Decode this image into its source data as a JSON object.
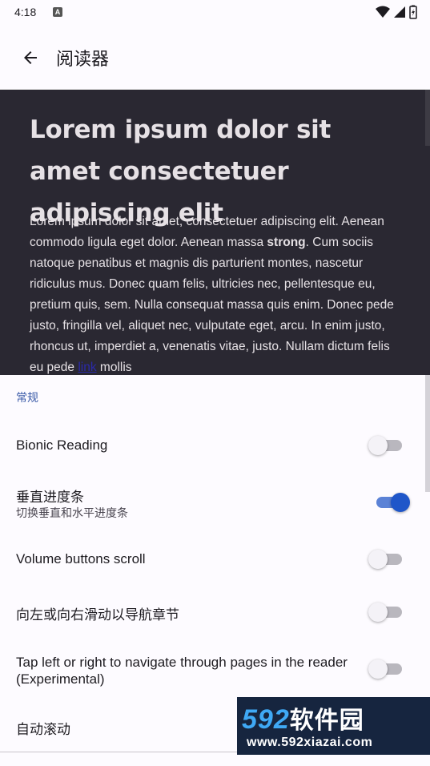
{
  "status_bar": {
    "time": "4:18",
    "notification_icon": "A",
    "icons": [
      "wifi-icon",
      "signal-icon",
      "battery-charging-icon"
    ]
  },
  "app_bar": {
    "back_icon": "arrow-left-icon",
    "title": "阅读器"
  },
  "preview": {
    "title": "Lorem ipsum dolor sit amet consectetuer adipiscing elit",
    "body_before_strong": "Lorem ipsum dolor sit amet, consectetuer adipiscing elit. Aenean commodo ligula eget dolor. Aenean massa ",
    "strong": "strong",
    "body_middle": ". Cum sociis natoque penatibus et magnis dis parturient montes, nascetur ridiculus mus. Donec quam felis, ultricies nec, pellentesque eu, pretium quis, sem. Nulla consequat massa quis enim. Donec pede justo, fringilla vel, aliquet nec, vulputate eget, arcu. In enim justo, rhoncus ut, imperdiet a, venenatis vitae, justo. Nullam dictum felis eu pede ",
    "link": "link",
    "body_after_link": " mollis"
  },
  "settings": {
    "section_header": "常规",
    "items": [
      {
        "title": "Bionic Reading",
        "summary": "",
        "checked": false
      },
      {
        "title": "垂直进度条",
        "summary": "切换垂直和水平进度条",
        "checked": true
      },
      {
        "title": "Volume buttons scroll",
        "summary": "",
        "checked": false
      },
      {
        "title": "向左或向右滑动以导航章节",
        "summary": "",
        "checked": false
      },
      {
        "title": "Tap left or right to navigate through pages in the reader (Experimental)",
        "summary": "",
        "checked": false
      },
      {
        "title": "自动滚动",
        "summary": "",
        "checked": false
      }
    ]
  },
  "watermark": {
    "brand_number": "592",
    "brand_text": "软件园",
    "url": "www.592xiazai.com"
  },
  "colors": {
    "accent": "#1f56c9",
    "preview_background": "#2a2832",
    "section_header": "#3a5aa8"
  }
}
